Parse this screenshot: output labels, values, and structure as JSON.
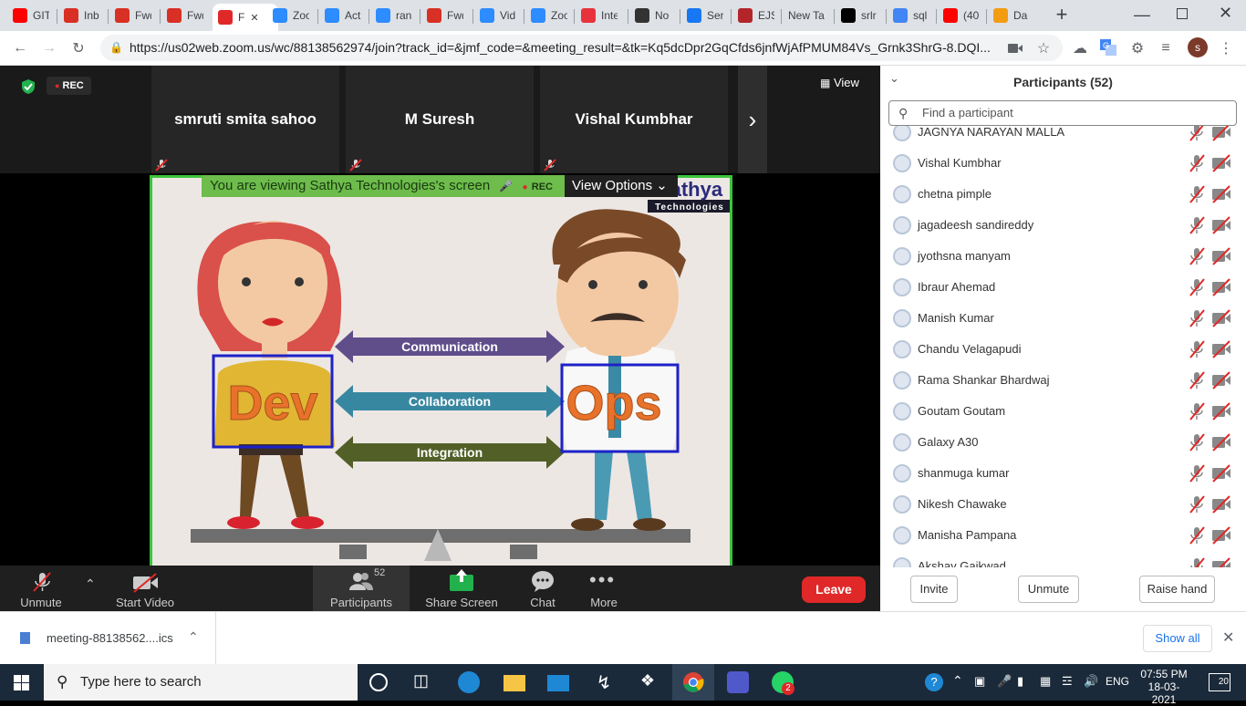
{
  "browser": {
    "tabs": [
      {
        "label": "GIT",
        "fav": "youtube-icon",
        "color": "#ff0000"
      },
      {
        "label": "Inb",
        "fav": "gmail-icon",
        "color": "#d93025"
      },
      {
        "label": "Fwd",
        "fav": "gmail-icon",
        "color": "#d93025"
      },
      {
        "label": "Fwd",
        "fav": "gmail-icon",
        "color": "#d93025"
      },
      {
        "label": "F",
        "fav": "zoom-record-icon",
        "color": "#e02828"
      },
      {
        "label": "Zoo",
        "fav": "zoom-icon",
        "color": "#2d8cff"
      },
      {
        "label": "Act",
        "fav": "zoom-icon",
        "color": "#2d8cff"
      },
      {
        "label": "ran",
        "fav": "zoom-icon",
        "color": "#2d8cff"
      },
      {
        "label": "Fwd",
        "fav": "gmail-icon",
        "color": "#d93025"
      },
      {
        "label": "Vid",
        "fav": "zoom-icon",
        "color": "#2d8cff"
      },
      {
        "label": "Zoo",
        "fav": "zoom-icon",
        "color": "#2d8cff"
      },
      {
        "label": "Inte",
        "fav": "r-icon",
        "color": "#e8333c"
      },
      {
        "label": "No",
        "fav": "no-icon",
        "color": "#333333"
      },
      {
        "label": "Ser",
        "fav": "f-icon",
        "color": "#1877f2"
      },
      {
        "label": "EJS",
        "fav": "ejs-icon",
        "color": "#b4252a"
      },
      {
        "label": "New Ta",
        "fav": "",
        "color": "#dee1e6"
      },
      {
        "label": "srlr",
        "fav": "github-icon",
        "color": "#000000"
      },
      {
        "label": "sql",
        "fav": "google-icon",
        "color": "#4285f4"
      },
      {
        "label": "(40",
        "fav": "youtube-icon",
        "color": "#ff0000"
      },
      {
        "label": "Da",
        "fav": "da-icon",
        "color": "#f39c12"
      }
    ],
    "url": "https://us02web.zoom.us/wc/88138562974/join?track_id=&jmf_code=&meeting_result=&tk=Kq5dcDpr2GqCfds6jnfWjAfPMUM84Vs_Grnk3ShrG-8.DQI...",
    "profile_letter": "s"
  },
  "zoom": {
    "rec_label": "REC",
    "view_label": "View",
    "participants_top": [
      "smruti smita sahoo",
      "M Suresh",
      "Vishal Kumbhar"
    ],
    "banner_text": "You are viewing Sathya Technologies's screen",
    "banner_rec": "REC",
    "view_options": "View Options",
    "slide": {
      "logo_text": "Sathya",
      "logo_sub": "Technologies",
      "arrows": [
        "Communication",
        "Collaboration",
        "Integration"
      ],
      "dev": "Dev",
      "ops": "Ops"
    },
    "toolbar": {
      "unmute": "Unmute",
      "start_video": "Start Video",
      "participants": "Participants",
      "participants_count": "52",
      "share_screen": "Share Screen",
      "chat": "Chat",
      "more": "More",
      "leave": "Leave"
    }
  },
  "panel": {
    "title": "Participants (52)",
    "search_placeholder": "Find a participant",
    "participants": [
      "JAGNYA NARAYAN MALLA",
      "Vishal Kumbhar",
      "chetna pimple",
      "jagadeesh sandireddy",
      "jyothsna manyam",
      "Ibraur Ahemad",
      "Manish Kumar",
      "Chandu Velagapudi",
      "Rama Shankar Bhardwaj",
      "Goutam Goutam",
      "Galaxy A30",
      "shanmuga kumar",
      "Nikesh Chawake",
      "Manisha Pampana",
      "Akshay Gaikwad"
    ],
    "invite": "Invite",
    "unmute": "Unmute",
    "raise_hand": "Raise hand"
  },
  "download": {
    "file": "meeting-88138562....ics",
    "show_all": "Show all"
  },
  "taskbar": {
    "search_placeholder": "Type here to search",
    "language": "ENG",
    "time": "07:55 PM",
    "date": "18-03-2021",
    "notification_count": "20",
    "whatsapp_badge": "2"
  }
}
